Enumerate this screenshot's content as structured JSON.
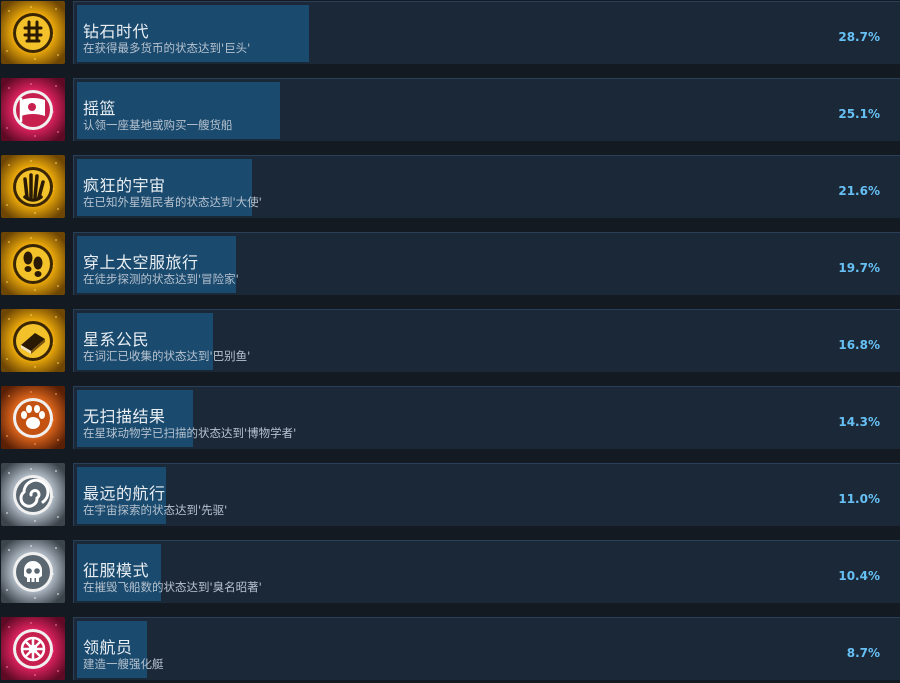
{
  "achievements": [
    {
      "title": "钻石时代",
      "description": "在获得最多货币的状态达到'巨头'",
      "percent_text": "28.7%",
      "percent": 28.7,
      "icon": "coin-icon",
      "theme": "gold"
    },
    {
      "title": "摇篮",
      "description": "认领一座基地或购买一艘货船",
      "percent_text": "25.1%",
      "percent": 25.1,
      "icon": "flag-icon",
      "theme": "pink"
    },
    {
      "title": "疯狂的宇宙",
      "description": "在已知外星殖民者的状态达到'大使'",
      "percent_text": "21.6%",
      "percent": 21.6,
      "icon": "alien-hand-icon",
      "theme": "gold"
    },
    {
      "title": "穿上太空服旅行",
      "description": "在徒步探测的状态达到'冒险家'",
      "percent_text": "19.7%",
      "percent": 19.7,
      "icon": "footprints-icon",
      "theme": "gold"
    },
    {
      "title": "星系公民",
      "description": "在词汇已收集的状态达到'巴别鱼'",
      "percent_text": "16.8%",
      "percent": 16.8,
      "icon": "book-icon",
      "theme": "gold"
    },
    {
      "title": "无扫描结果",
      "description": "在星球动物学已扫描的状态达到'博物学者'",
      "percent_text": "14.3%",
      "percent": 14.3,
      "icon": "paw-print-icon",
      "theme": "orange"
    },
    {
      "title": "最远的航行",
      "description": "在宇宙探索的状态达到'先驱'",
      "percent_text": "11.0%",
      "percent": 11.0,
      "icon": "spiral-galaxy-icon",
      "theme": "silver"
    },
    {
      "title": "征服模式",
      "description": "在摧毁飞船数的状态达到'臭名昭著'",
      "percent_text": "10.4%",
      "percent": 10.4,
      "icon": "skull-icon",
      "theme": "silver"
    },
    {
      "title": "领航员",
      "description": "建造一艘强化艇",
      "percent_text": "8.7%",
      "percent": 8.7,
      "icon": "ship-wheel-icon",
      "theme": "pink"
    }
  ],
  "colors": {
    "background": "#141a22",
    "panel": "#1b2838",
    "progress_bar": "#1a4a6e",
    "percent_text": "#66c0f4"
  }
}
